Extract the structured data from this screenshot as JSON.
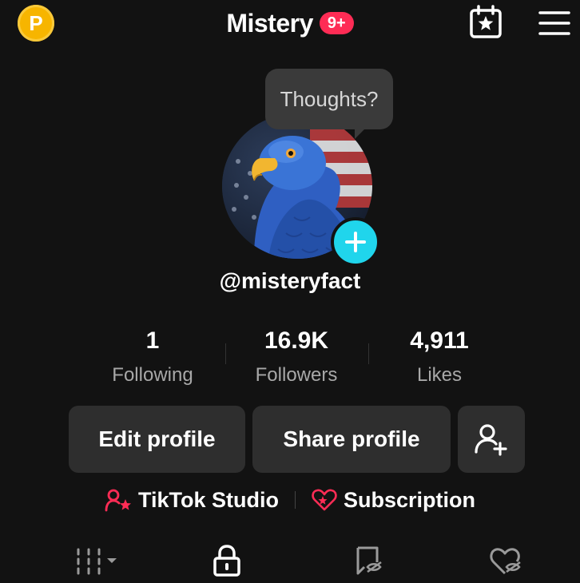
{
  "header": {
    "coin_letter": "P",
    "title": "Mistery",
    "badge": "9+"
  },
  "bubble": {
    "text": "Thoughts?"
  },
  "profile": {
    "username": "@misteryfact"
  },
  "stats": [
    {
      "value": "1",
      "label": "Following"
    },
    {
      "value": "16.9K",
      "label": "Followers"
    },
    {
      "value": "4,911",
      "label": "Likes"
    }
  ],
  "buttons": {
    "edit": "Edit profile",
    "share": "Share profile"
  },
  "links": {
    "studio": "TikTok Studio",
    "subscription": "Subscription"
  },
  "colors": {
    "accent": "#fe2c55",
    "plus": "#20d5ec",
    "coin": "#f7b500"
  }
}
